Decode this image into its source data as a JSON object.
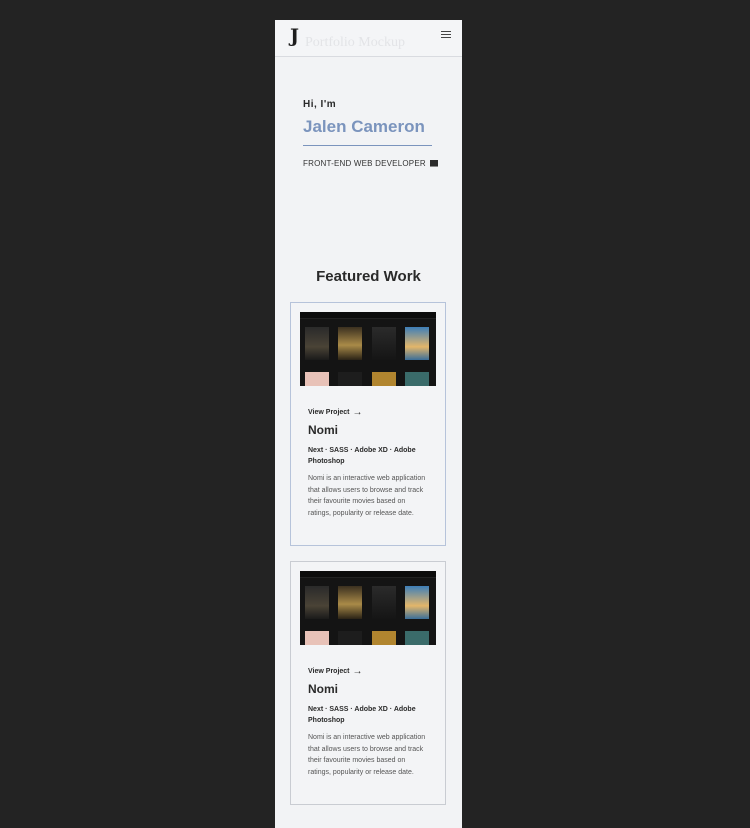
{
  "header": {
    "logo_text": "J",
    "ghost_title": "Portfolio Mockup",
    "menu_icon": "hamburger-menu-icon"
  },
  "hero": {
    "greeting": "Hi, I'm",
    "name": "Jalen Cameron",
    "role": "FRONT-END WEB DEVELOPER",
    "role_icon": "laptop-icon"
  },
  "featured": {
    "title": "Featured Work",
    "cards": [
      {
        "view_label": "View Project",
        "title": "Nomi",
        "tech": "Next · SASS · Adobe XD · Adobe Photoshop",
        "description": "Nomi is an interactive web application that allows users to browse and track their favourite movies based on ratings, popularity or release date."
      },
      {
        "view_label": "View Project",
        "title": "Nomi",
        "tech": "Next · SASS · Adobe XD · Adobe Photoshop",
        "description": "Nomi is an interactive web application that allows users to browse and track their favourite movies based on ratings, popularity or release date."
      }
    ]
  },
  "colors": {
    "accent": "#7b94bd",
    "page_bg": "#f2f3f5",
    "outer_bg": "#232323"
  }
}
